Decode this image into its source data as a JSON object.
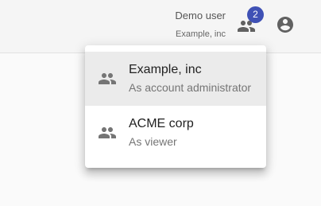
{
  "header": {
    "user_name": "Demo user",
    "current_org": "Example, inc",
    "accounts_badge_count": "2",
    "badge_color": "#3f51b5",
    "icons": {
      "accounts": "people-icon",
      "profile": "account-circle-icon"
    }
  },
  "account_menu": {
    "items": [
      {
        "name": "Example, inc",
        "role": "As account administrator",
        "icon": "people-icon",
        "selected": true
      },
      {
        "name": "ACME corp",
        "role": "As viewer",
        "icon": "people-icon",
        "selected": false
      }
    ]
  }
}
